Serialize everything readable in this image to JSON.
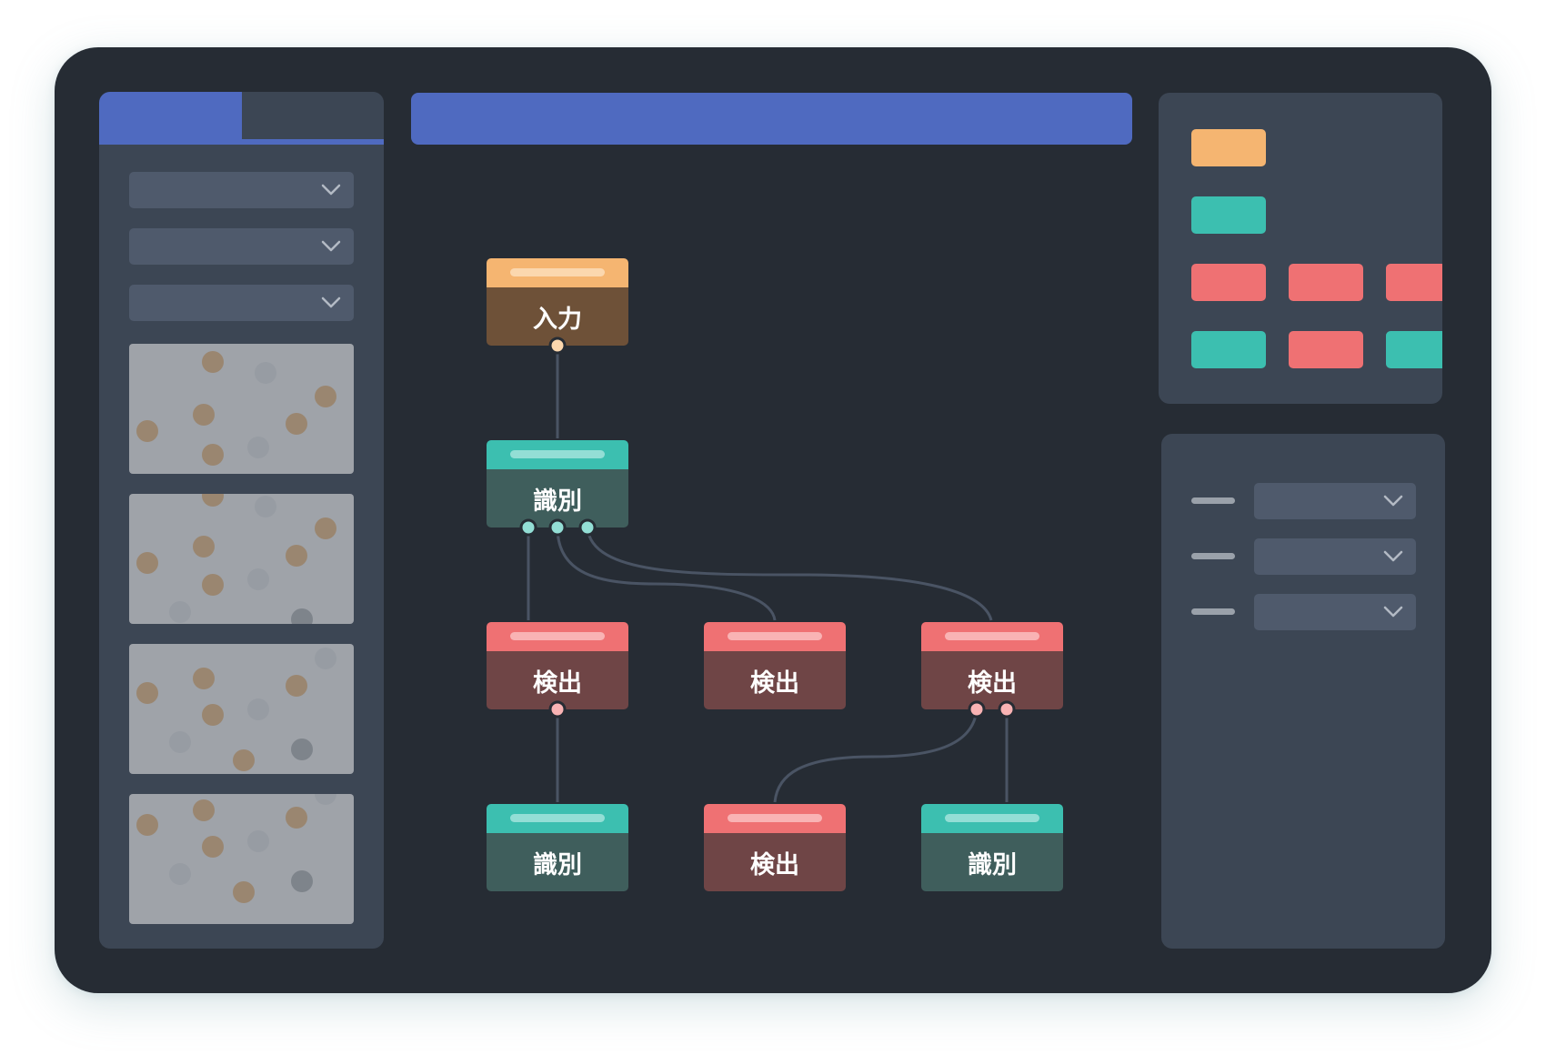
{
  "colors": {
    "background": "#262c34",
    "panel": "#3c4654",
    "accent_blue": "#4f6ac0",
    "input_node": "#f5b571",
    "identify_node": "#3cbfb0",
    "detect_node": "#ef7173"
  },
  "left_panel": {
    "tabs": [
      "",
      ""
    ],
    "dropdowns": [
      {
        "value": "",
        "icon": "chevron-down-icon"
      },
      {
        "value": "",
        "icon": "chevron-down-icon"
      },
      {
        "value": "",
        "icon": "chevron-down-icon"
      }
    ],
    "thumbnails": [
      "image-thumbnail",
      "image-thumbnail",
      "image-thumbnail",
      "image-thumbnail"
    ]
  },
  "toolbar": {
    "title": ""
  },
  "graph": {
    "nodes": [
      {
        "id": "input",
        "type": "input",
        "label": "入力"
      },
      {
        "id": "identify-1",
        "type": "identify",
        "label": "識別"
      },
      {
        "id": "detect-1",
        "type": "detect",
        "label": "検出"
      },
      {
        "id": "detect-2",
        "type": "detect",
        "label": "検出"
      },
      {
        "id": "detect-3",
        "type": "detect",
        "label": "検出"
      },
      {
        "id": "identify-2",
        "type": "identify",
        "label": "識別"
      },
      {
        "id": "detect-4",
        "type": "detect",
        "label": "検出"
      },
      {
        "id": "identify-3",
        "type": "identify",
        "label": "識別"
      }
    ],
    "edges": [
      [
        "input",
        "identify-1"
      ],
      [
        "identify-1",
        "detect-1"
      ],
      [
        "identify-1",
        "detect-2"
      ],
      [
        "identify-1",
        "detect-3"
      ],
      [
        "detect-1",
        "identify-2"
      ],
      [
        "detect-3",
        "detect-4"
      ],
      [
        "detect-3",
        "identify-3"
      ]
    ]
  },
  "palette": {
    "chips": [
      "input",
      "identify",
      "detect",
      "detect",
      "detect",
      "identify",
      "detect",
      "identify"
    ]
  },
  "properties": {
    "rows": [
      {
        "label": "",
        "value": "",
        "icon": "chevron-down-icon"
      },
      {
        "label": "",
        "value": "",
        "icon": "chevron-down-icon"
      },
      {
        "label": "",
        "value": "",
        "icon": "chevron-down-icon"
      }
    ]
  }
}
